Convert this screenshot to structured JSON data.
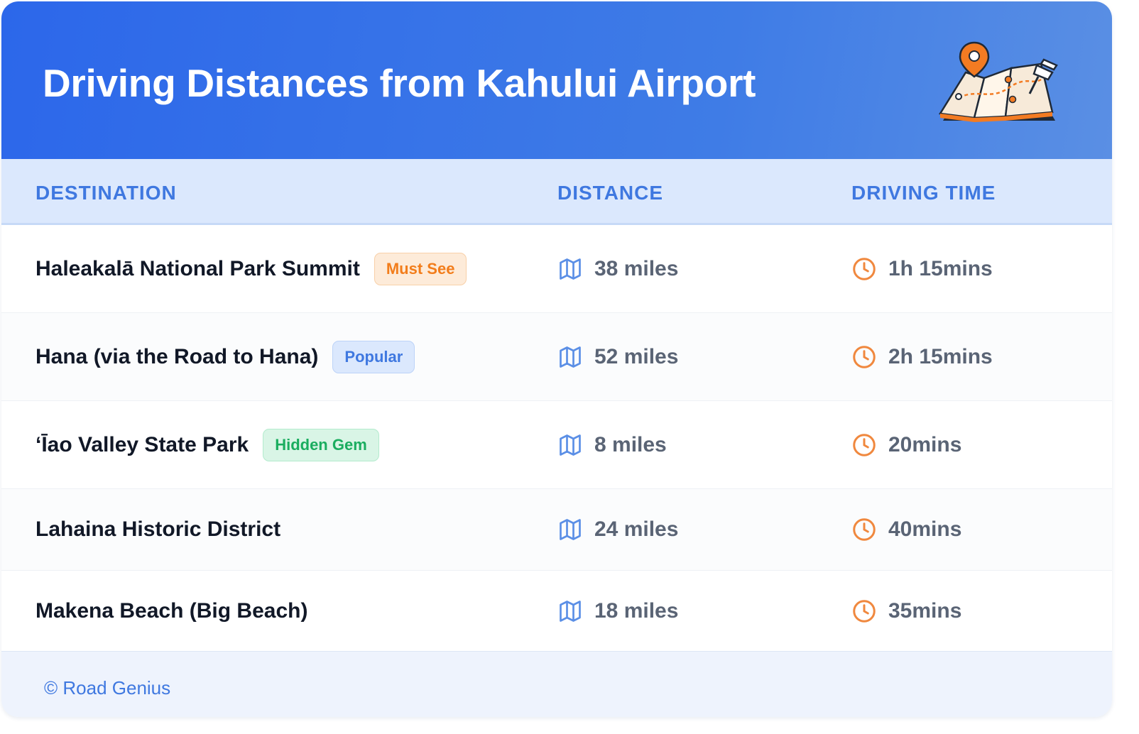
{
  "header": {
    "title": "Driving Distances from Kahului Airport",
    "illustration_icon": "folded-map-with-pins-icon"
  },
  "table": {
    "columns": [
      "DESTINATION",
      "DISTANCE",
      "DRIVING TIME"
    ],
    "distance_icon": "map-icon",
    "time_icon": "clock-icon",
    "rows": [
      {
        "destination": "Haleakalā National Park Summit",
        "badge": "Must See",
        "distance": "38 miles",
        "time": "1h 15mins"
      },
      {
        "destination": "Hana (via the Road to Hana)",
        "badge": "Popular",
        "distance": "52 miles",
        "time": "2h 15mins"
      },
      {
        "destination": "ʻĪao Valley State Park",
        "badge": "Hidden Gem",
        "distance": "8 miles",
        "time": "20mins"
      },
      {
        "destination": "Lahaina Historic District",
        "badge": "",
        "distance": "24 miles",
        "time": "40mins"
      },
      {
        "destination": "Makena Beach (Big Beach)",
        "badge": "",
        "distance": "18 miles",
        "time": "35mins"
      }
    ]
  },
  "footer": {
    "text": "© Road Genius"
  },
  "colors": {
    "header_gradient_start": "#2c67ea",
    "header_gradient_end": "#5a8fe4",
    "column_header_text": "#3f78e0",
    "must_see_badge": "#f27d1b",
    "popular_badge": "#3f78e0",
    "hidden_gem_badge": "#1aad5f",
    "clock_icon": "#f0883e",
    "map_icon": "#5b8fe6"
  }
}
